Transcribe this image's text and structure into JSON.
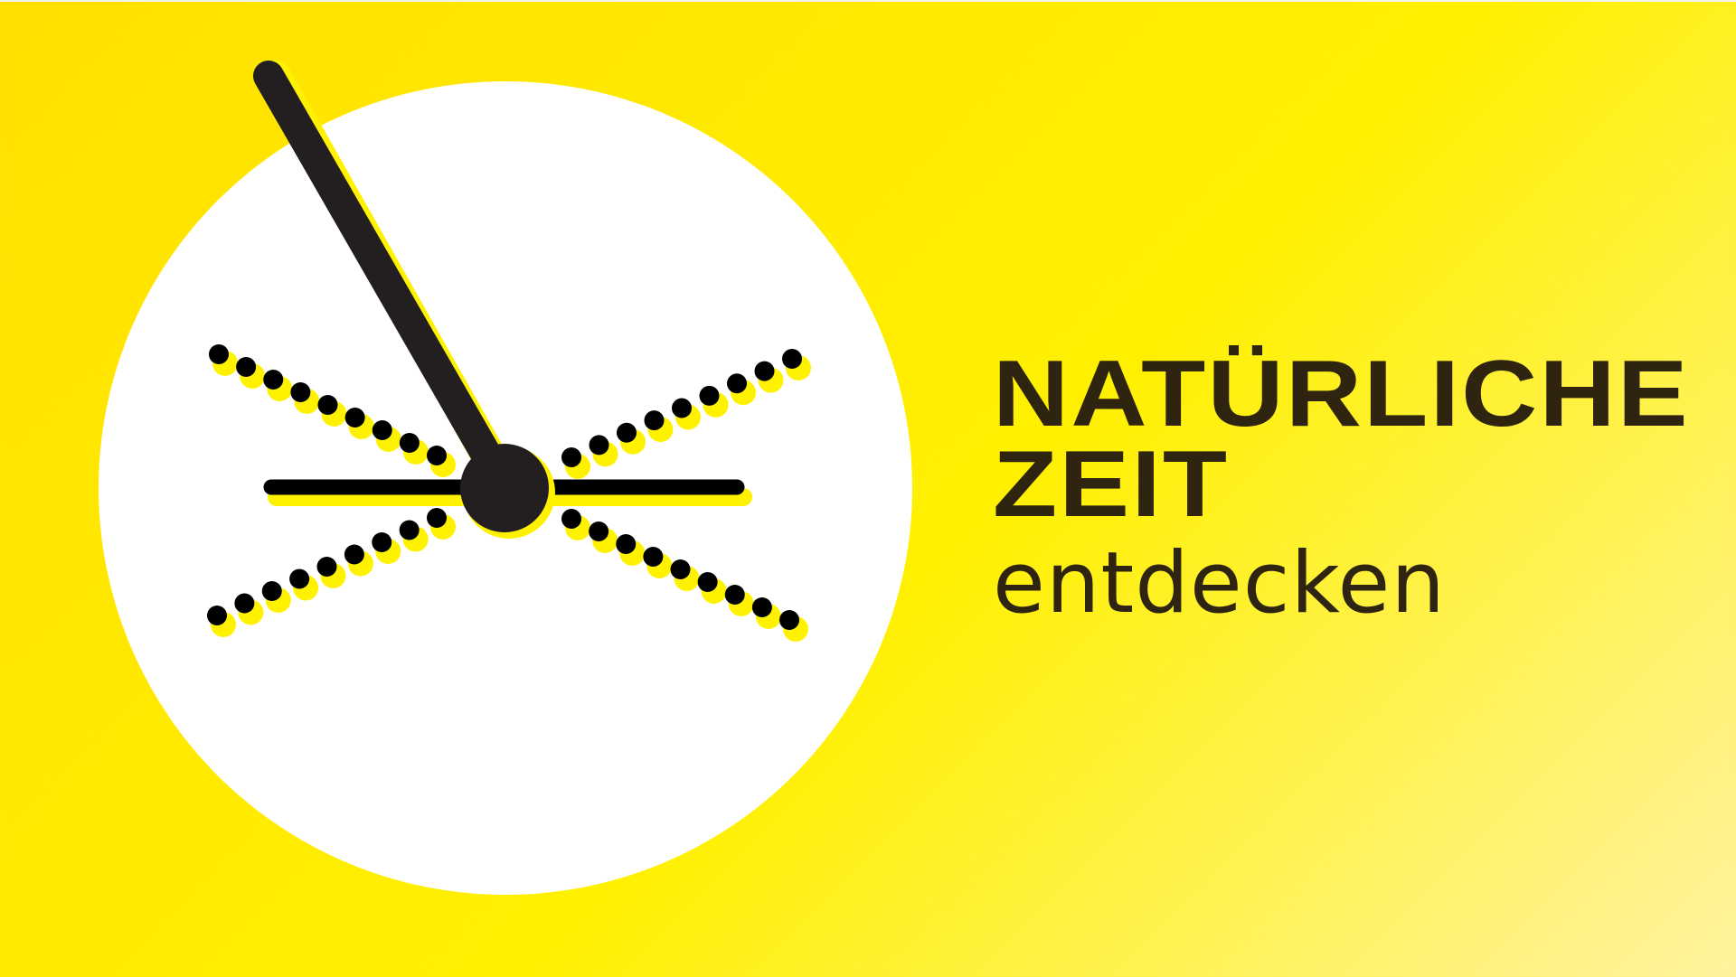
{
  "title_line_1": "NATÜRLICHE",
  "title_line_2": "ZEIT",
  "subtitle": "entdecken",
  "logo": {
    "icon": "clock-hand-icon",
    "colors": {
      "background": "#ffe600",
      "circle": "#ffffff",
      "ink": "#231f20",
      "shadow": "#fff200"
    }
  }
}
